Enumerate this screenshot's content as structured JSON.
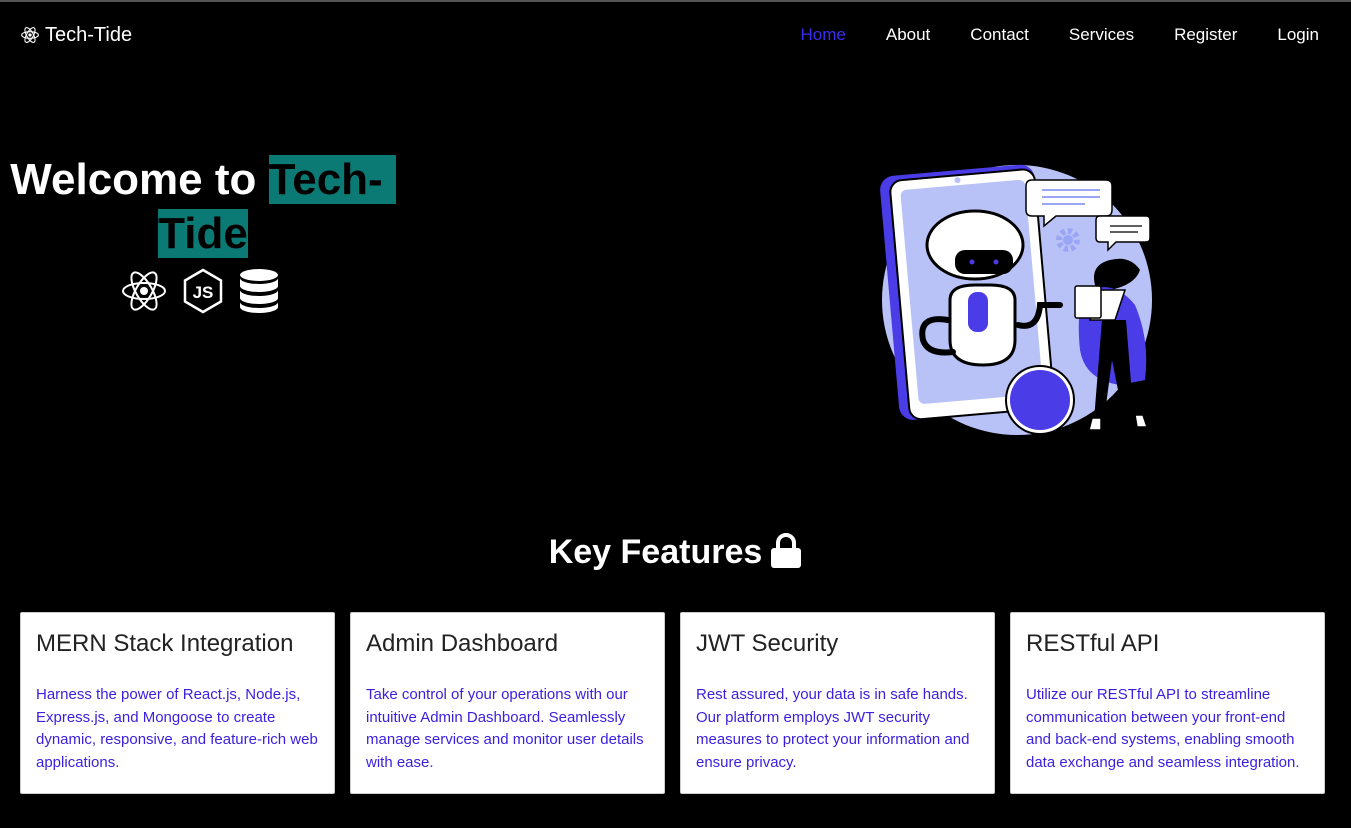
{
  "brand": {
    "name": "Tech-Tide",
    "icon": "react-atom-icon"
  },
  "nav": {
    "items": [
      {
        "label": "Home",
        "active": true
      },
      {
        "label": "About",
        "active": false
      },
      {
        "label": "Contact",
        "active": false
      },
      {
        "label": "Services",
        "active": false
      },
      {
        "label": "Register",
        "active": false
      },
      {
        "label": "Login",
        "active": false
      }
    ],
    "active_color": "#3b2ef0"
  },
  "hero": {
    "title_prefix": "Welcome to ",
    "title_highlight_1": "Tech-",
    "title_highlight_2": "Tide",
    "highlight_color": "#0b7a75",
    "icons": [
      "react-icon",
      "nodejs-icon",
      "database-icon"
    ]
  },
  "features": {
    "title": "Key Features",
    "icon": "lock-icon",
    "cards": [
      {
        "title": "MERN Stack Integration",
        "text": "Harness the power of React.js, Node.js, Express.js, and Mongoose to create dynamic, responsive, and feature-rich web applications."
      },
      {
        "title": "Admin Dashboard",
        "text": "Take control of your operations with our intuitive Admin Dashboard. Seamlessly manage services and monitor user details with ease."
      },
      {
        "title": "JWT Security",
        "text": "Rest assured, your data is in safe hands. Our platform employs JWT security measures to protect your information and ensure privacy."
      },
      {
        "title": "RESTful API",
        "text": "Utilize our RESTful API to streamline communication between your front-end and back-end systems, enabling smooth data exchange and seamless integration."
      }
    ]
  }
}
